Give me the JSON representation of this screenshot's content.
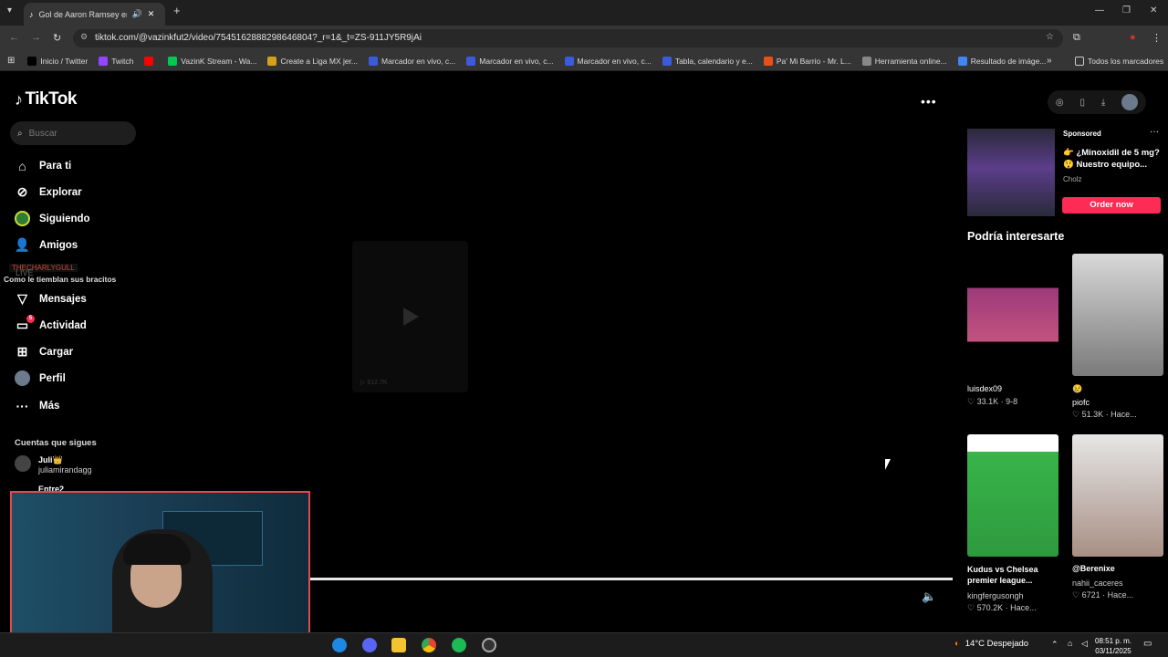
{
  "browser": {
    "tab_title": "Gol de Aaron Ramsey en Pu",
    "url": "tiktok.com/@vazinkfut2/video/7545162888298646804?_r=1&_t=ZS-911JY5R9jAi",
    "bookmarks": [
      {
        "label": "Inicio / Twitter",
        "color": "#000000"
      },
      {
        "label": "Twitch",
        "color": "#9146ff"
      },
      {
        "label": "",
        "color": "#ff0000"
      },
      {
        "label": "VazinK Stream - Wa...",
        "color": "#00c853"
      },
      {
        "label": "Create a Liga MX jer...",
        "color": "#d4a017"
      },
      {
        "label": "Marcador en vivo, c...",
        "color": "#3b5bdb"
      },
      {
        "label": "Marcador en vivo, c...",
        "color": "#3b5bdb"
      },
      {
        "label": "Marcador en vivo, c...",
        "color": "#3b5bdb"
      },
      {
        "label": "Tabla, calendario y e...",
        "color": "#3b5bdb"
      },
      {
        "label": "Pa' Mi Barrio - Mr. L...",
        "color": "#e8501a"
      },
      {
        "label": "Herramienta online...",
        "color": "#888888"
      },
      {
        "label": "Resultado de imáge...",
        "color": "#4285f4"
      }
    ],
    "all_bookmarks": "Todos los marcadores"
  },
  "tiktok": {
    "logo": "TikTok",
    "search_placeholder": "Buscar",
    "nav": {
      "para_ti": "Para ti",
      "explorar": "Explorar",
      "siguiendo": "Siguiendo",
      "amigos": "Amigos",
      "live": "LIVE",
      "mensajes": "Mensajes",
      "actividad": "Actividad",
      "actividad_badge": "5",
      "cargar": "Cargar",
      "perfil": "Perfil",
      "mas": "Más"
    },
    "overlay_user": "THECHARLYGULL",
    "overlay_caption": "Como le tiemblan sus bracitos",
    "following_title": "Cuentas que sigues",
    "following": [
      {
        "name": "Juli👑",
        "handle": "juliamirandagg"
      },
      {
        "name": "Entre2",
        "handle": ""
      }
    ],
    "video_views": "612.7K",
    "sponsored": {
      "label": "Sponsored",
      "title": "👉 ¿Minoxidil de 5 mg? 😲 Nuestro equipo...",
      "brand": "Cholz",
      "cta": "Order now"
    },
    "recommend_title": "Podría interesarte",
    "recommendations": [
      {
        "title": "",
        "user": "luisdex09",
        "likes": "33.1K",
        "date": "9-8"
      },
      {
        "title": "😢",
        "user": "piofc",
        "likes": "51.3K",
        "date": "Hace..."
      },
      {
        "title": "Kudus vs Chelsea premier league...",
        "user": "kingfergusongh",
        "likes": "570.2K",
        "date": "Hace..."
      },
      {
        "title": "@Berenixe",
        "user": "nahii_caceres",
        "likes": "6721",
        "date": "Hace..."
      }
    ]
  },
  "taskbar": {
    "weather": "14°C  Despejado",
    "time": "08:51 p. m.",
    "date": "03/11/2025"
  }
}
